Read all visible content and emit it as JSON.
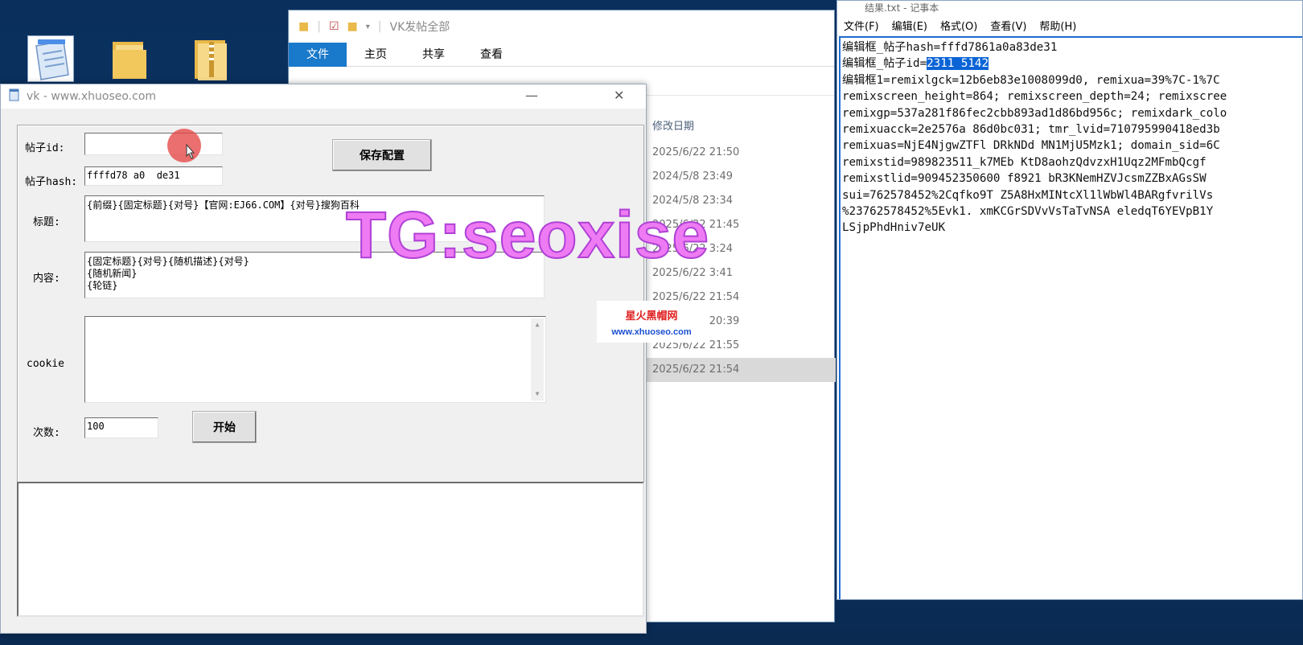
{
  "explorer": {
    "title": "VK发帖全部",
    "ribbon_tabs": [
      "文件",
      "主页",
      "共享",
      "查看"
    ],
    "column_header": "修改日期",
    "rows": [
      "2025/6/22 21:50",
      "2024/5/8 23:49",
      "2024/5/8 23:34",
      "2025/6/22 21:45",
      "2025/6/22 3:24",
      "2025/6/22 3:41",
      "2025/6/22 21:54",
      "2021/5/22 20:39",
      "2025/6/22 21:55",
      "2025/6/22 21:54"
    ]
  },
  "notepad": {
    "title": "结果.txt - 记事本",
    "menu": [
      "文件(F)",
      "编辑(E)",
      "格式(O)",
      "查看(V)",
      "帮助(H)"
    ],
    "line1": "编辑框_帖子hash=fffd7861a0a83de31",
    "line2_prefix": "编辑框_帖子id=",
    "line2_selected": "2311 5142",
    "lines": [
      "编辑框1=remixlgck=12b6eb83e1008099d0, remixua=39%7C-1%7C",
      "remixscreen_height=864; remixscreen_depth=24; remixscree",
      "remixgp=537a281f86fec2cbb893ad1d86bd956c; remixdark_colo",
      "remixuacck=2e2576a 86d0bc031; tmr_lvid=710795990418ed3b",
      "remixuas=NjE4NjgwZTFl DRkNDd MN1MjU5Mzk1; domain_sid=6C",
      "remixstid=989823511_k7MEb KtD8aohzQdvzxH1Uqz2MFmbQcgf",
      "remixstlid=909452350600 f8921 bR3KNemHZVJcsmZZBxAGsSW",
      "sui=762578452%2Cqfko9T Z5A8HxMINtcXl1lWbWl4BARgfvrilVs",
      "%23762578452%5Evk1. xmKCGrSDVvVsTaTvNSA eledqT6YEVpB1Y",
      "LSjpPhdHniv7eUK"
    ]
  },
  "vk": {
    "title": "vk - www.xhuoseo.com",
    "post_id_label": "帖子id:",
    "post_id_value": "",
    "post_hash_label": "帖子hash:",
    "post_hash_value": "ffffd78 a0  de31",
    "save_button": "保存配置",
    "title_label": "标题:",
    "title_value": "{前缀}{固定标题}{对号}【官网:EJ66.COM】{对号}搜狗百科",
    "content_label": "内容:",
    "content_value": "{固定标题}{对号}{随机描述}{对号}\n{随机新闻}\n{轮链}",
    "cookie_label": "cookie",
    "cookie_value": "",
    "count_label": "次数:",
    "count_value": "100",
    "start_button": "开始",
    "output": ""
  },
  "overlay": {
    "watermark": "TG:seoxise",
    "brand_line1": "星火黑帽网",
    "brand_line2": "www.xhuoseo.com"
  }
}
